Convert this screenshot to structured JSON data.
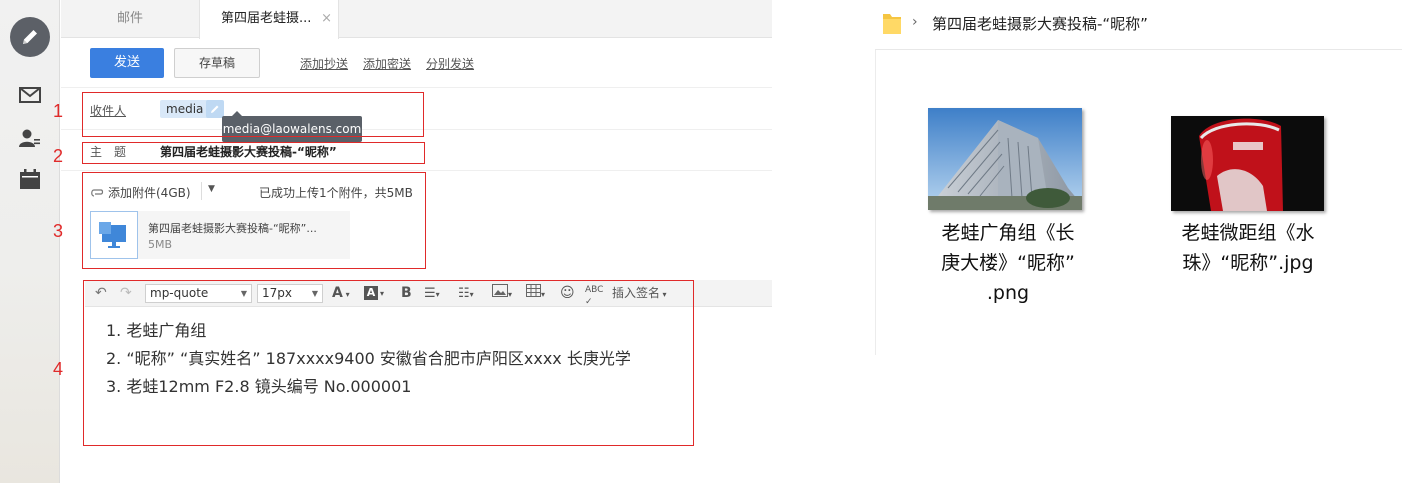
{
  "mail": {
    "tabs": [
      {
        "label": "邮件"
      },
      {
        "label": "第四届老蛙摄...",
        "close": "×"
      }
    ],
    "toolbar": {
      "send": "发送",
      "draft": "存草稿",
      "add_cc": "添加抄送",
      "add_bcc": "添加密送",
      "separate_send": "分别发送"
    },
    "recipient": {
      "label": "收件人",
      "chip": "media",
      "tooltip": "media@laowalens.com"
    },
    "subject": {
      "label": "主　题",
      "value": "第四届老蛙摄影大赛投稿-“昵称”"
    },
    "attachment": {
      "add_label": "添加附件(4GB)",
      "status": "已成功上传1个附件，共5MB",
      "file_name": "第四届老蛙摄影大赛投稿-“昵称”...",
      "file_size": "5MB"
    },
    "editor": {
      "format": "mp-quote",
      "font_size": "17px",
      "signature": "插入签名",
      "body_lines": [
        "1. 老蛙广角组",
        "2. “昵称” “真实姓名” 187xxxx9400  安徽省合肥市庐阳区xxxx 长庚光学",
        "3. 老蛙12mm F2.8  镜头编号 No.000001"
      ]
    }
  },
  "annotations": [
    "1",
    "2",
    "3",
    "4"
  ],
  "explorer": {
    "path": "第四届老蛙摄影大赛投稿-“昵称”",
    "files": [
      {
        "name_lines": [
          "老蛙广角组《长",
          "庚大楼》“昵称”",
          ".png"
        ]
      },
      {
        "name_lines": [
          "老蛙微距组《水",
          "珠》“昵称”.jpg"
        ]
      }
    ]
  },
  "colors": {
    "accent": "#3a7fe0",
    "annotation": "#e02a2a"
  }
}
